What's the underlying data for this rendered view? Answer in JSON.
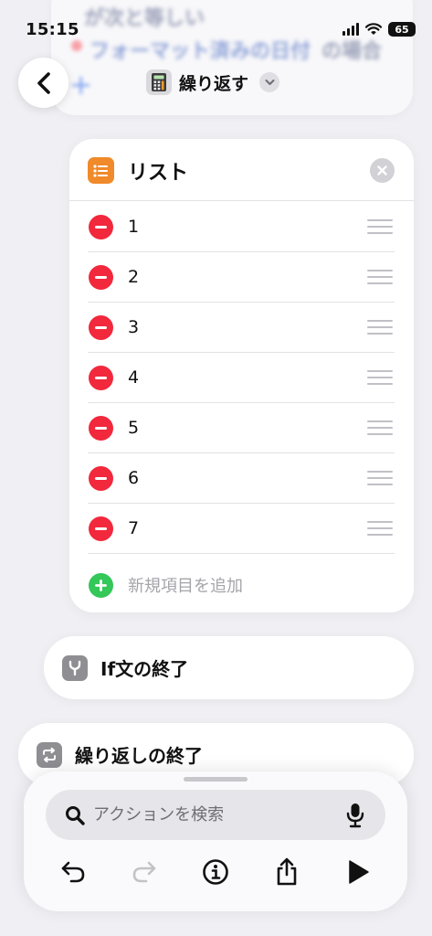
{
  "status_bar": {
    "time": "15:15",
    "battery": "65"
  },
  "background": {
    "line1": "が次と等しい",
    "line2": "フォーマット済みの日付",
    "line3": "の場合"
  },
  "nav": {
    "title": "繰り返す"
  },
  "list_card": {
    "title": "リスト",
    "items": [
      "1",
      "2",
      "3",
      "4",
      "5",
      "6",
      "7"
    ],
    "add_placeholder": "新規項目を追加"
  },
  "blocks": {
    "if_end": "If文の終了",
    "repeat_end": "繰り返しの終了"
  },
  "bottom_sheet": {
    "search_placeholder": "アクションを検索"
  },
  "colors": {
    "remove": "#f2283c",
    "add": "#34c759",
    "list_icon": "#f08a2a",
    "block_icon": "#8e8e93"
  },
  "icons": {
    "back": "chevron-left-icon",
    "app": "calculator-icon",
    "title_menu": "chevron-down-icon",
    "list": "list-icon",
    "clear": "close-icon",
    "remove": "minus-circle-icon",
    "reorder": "drag-handle-icon",
    "add": "plus-circle-icon",
    "if": "branch-icon",
    "repeat": "repeat-icon",
    "search": "search-icon",
    "mic": "microphone-icon",
    "undo": "undo-icon",
    "redo": "redo-icon",
    "info": "info-icon",
    "share": "share-icon",
    "play": "play-icon"
  }
}
